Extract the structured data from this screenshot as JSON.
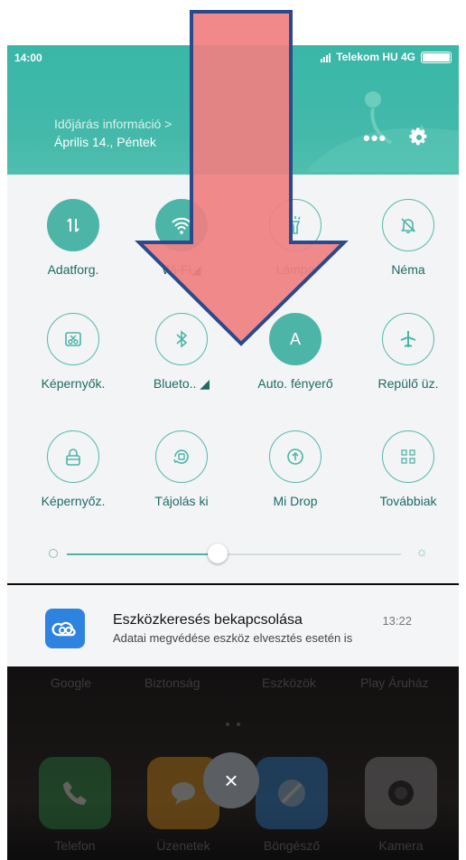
{
  "status_bar": {
    "time": "14:00",
    "carrier": "Telekom HU 4G"
  },
  "header": {
    "weather_title": "Időjárás információ >",
    "date": "Április 14., Péntek",
    "more": "•••"
  },
  "toggles": [
    {
      "label": "Adatforg.",
      "icon": "data-arrows-icon",
      "active": true
    },
    {
      "label": "Wi-Fi◢",
      "icon": "wifi-icon",
      "active": true
    },
    {
      "label": "Lámpa",
      "icon": "flashlight-icon",
      "active": false
    },
    {
      "label": "Néma",
      "icon": "bell-off-icon",
      "active": false
    },
    {
      "label": "Képernyők.",
      "icon": "screenshot-icon",
      "active": false
    },
    {
      "label": "Blueto.. ◢",
      "icon": "bluetooth-icon",
      "active": false
    },
    {
      "label": "Auto. fényerő",
      "icon": "auto-brightness-icon",
      "active": true
    },
    {
      "label": "Repülő üz.",
      "icon": "airplane-icon",
      "active": false
    },
    {
      "label": "Képernyőz.",
      "icon": "lock-icon",
      "active": false
    },
    {
      "label": "Tájolás ki",
      "icon": "rotation-icon",
      "active": false
    },
    {
      "label": "Mi Drop",
      "icon": "upload-icon",
      "active": false
    },
    {
      "label": "Továbbiak",
      "icon": "grid-icon",
      "active": false
    }
  ],
  "brightness": {
    "level": 0.45
  },
  "notification": {
    "title": "Eszközkeresés bekapcsolása",
    "time": "13:22",
    "body": "Adatai megvédése eszköz elvesztés esetén is"
  },
  "home": {
    "folders": [
      "Google",
      "Biztonság",
      "Eszközök",
      "Play Áruház"
    ],
    "apps": [
      {
        "label": "Telefon",
        "color": "#2e9c4a"
      },
      {
        "label": "Üzenetek",
        "color": "#f2a01b"
      },
      {
        "label": "Böngésző",
        "color": "#2f8fe6"
      },
      {
        "label": "Kamera",
        "color": "#9a9a9a"
      }
    ],
    "close": "×"
  },
  "colors": {
    "accent": "#4db5a7",
    "arrow_fill": "#f07f80",
    "arrow_stroke": "#2b4a8c"
  }
}
